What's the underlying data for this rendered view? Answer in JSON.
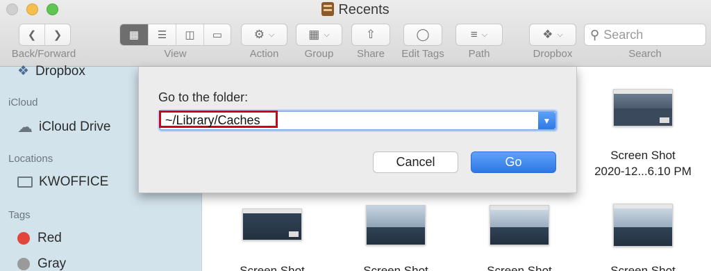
{
  "window": {
    "title": "Recents"
  },
  "toolbar": {
    "back_forward_label": "Back/Forward",
    "view_label": "View",
    "action_label": "Action",
    "group_label": "Group",
    "share_label": "Share",
    "edit_tags_label": "Edit Tags",
    "path_label": "Path",
    "dropbox_label": "Dropbox",
    "search_label": "Search",
    "search_placeholder": "Search"
  },
  "sidebar": {
    "dropbox_item": "Dropbox",
    "icloud_heading": "iCloud",
    "icloud_drive": "iCloud Drive",
    "locations_heading": "Locations",
    "location_item": "KWOFFICE",
    "tags_heading": "Tags",
    "tags": [
      {
        "label": "Red",
        "color": "#e2453c"
      },
      {
        "label": "Gray",
        "color": "#9a9a9a"
      }
    ]
  },
  "content": {
    "files": [
      {
        "name_line1": "Screen Shot",
        "name_line2": "2020-12...6.10 PM"
      }
    ],
    "partial_label": "Screen Shot"
  },
  "dialog": {
    "prompt": "Go to the folder:",
    "path_value": "~/Library/Caches",
    "cancel_label": "Cancel",
    "go_label": "Go"
  },
  "colors": {
    "accent": "#2f79e6",
    "highlight_border": "#d0021b",
    "sidebar_bg": "#d3e3ec"
  }
}
